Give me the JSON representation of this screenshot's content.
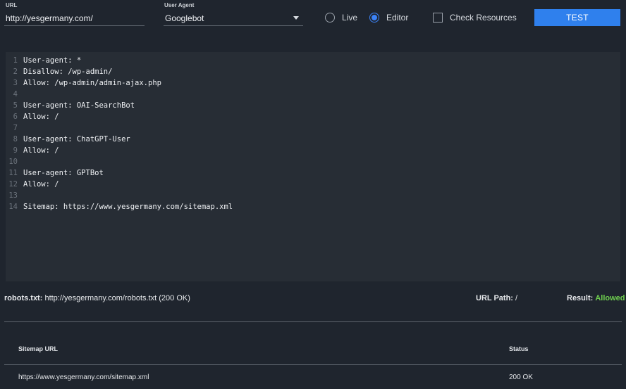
{
  "form": {
    "url_label": "URL",
    "url_value": "http://yesgermany.com/",
    "ua_label": "User Agent",
    "ua_value": "Googlebot",
    "mode_live": "Live",
    "mode_editor": "Editor",
    "selected_mode": "Editor",
    "check_resources": "Check Resources",
    "check_resources_checked": false,
    "test_button": "TEST"
  },
  "editor": {
    "lines": [
      {
        "n": "1",
        "text": "User-agent: *"
      },
      {
        "n": "2",
        "text": "Disallow: /wp-admin/"
      },
      {
        "n": "3",
        "text": "Allow: /wp-admin/admin-ajax.php"
      },
      {
        "n": "4",
        "text": ""
      },
      {
        "n": "5",
        "text": "User-agent: OAI-SearchBot"
      },
      {
        "n": "6",
        "text": "Allow: /"
      },
      {
        "n": "7",
        "text": ""
      },
      {
        "n": "8",
        "text": "User-agent: ChatGPT-User"
      },
      {
        "n": "9",
        "text": "Allow: /"
      },
      {
        "n": "10",
        "text": ""
      },
      {
        "n": "11",
        "text": "User-agent: GPTBot"
      },
      {
        "n": "12",
        "text": "Allow: /"
      },
      {
        "n": "13",
        "text": ""
      },
      {
        "n": "14",
        "text": "Sitemap: https://www.yesgermany.com/sitemap.xml"
      }
    ]
  },
  "status": {
    "robots_label": "robots.txt:",
    "robots_value": "http://yesgermany.com/robots.txt (200 OK)",
    "url_path_label": "URL Path:",
    "url_path_value": "/",
    "result_label": "Result:",
    "result_value": "Allowed",
    "result_color": "#6fcf4f"
  },
  "sitemaps": {
    "col_url": "Sitemap URL",
    "col_status": "Status",
    "rows": [
      {
        "url": "https://www.yesgermany.com/sitemap.xml",
        "status": "200 OK"
      }
    ]
  },
  "colors": {
    "background": "#1f252e",
    "editor_background": "#272d35",
    "accent": "#2f80ed"
  }
}
